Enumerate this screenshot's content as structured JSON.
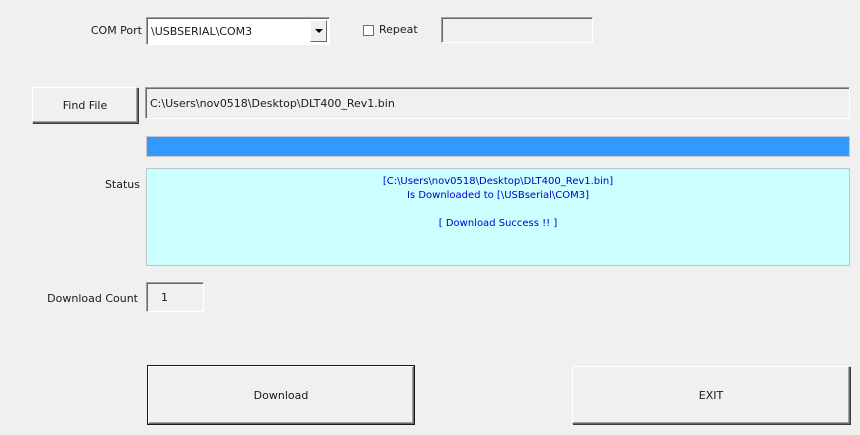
{
  "com_port": {
    "label": "COM Port",
    "selected": "\\USBSERIAL\\COM3"
  },
  "repeat": {
    "label": "Repeat",
    "checked": false,
    "value": ""
  },
  "find_file": {
    "button_label": "Find File",
    "path": "C:\\Users\\nov0518\\Desktop\\DLT400_Rev1.bin"
  },
  "progress": {
    "value": 1.0,
    "color": "#3399ff"
  },
  "status": {
    "label": "Status",
    "lines": [
      "[C:\\Users\\nov0518\\Desktop\\DLT400_Rev1.bin]",
      "Is Downloaded to [\\USBserial\\COM3]",
      "",
      "[ Download Success !! ]"
    ],
    "text_color": "#0000c8",
    "background": "#ccffff"
  },
  "download_count": {
    "label": "Download Count",
    "value": "1"
  },
  "buttons": {
    "download": "Download",
    "exit": "EXIT"
  }
}
